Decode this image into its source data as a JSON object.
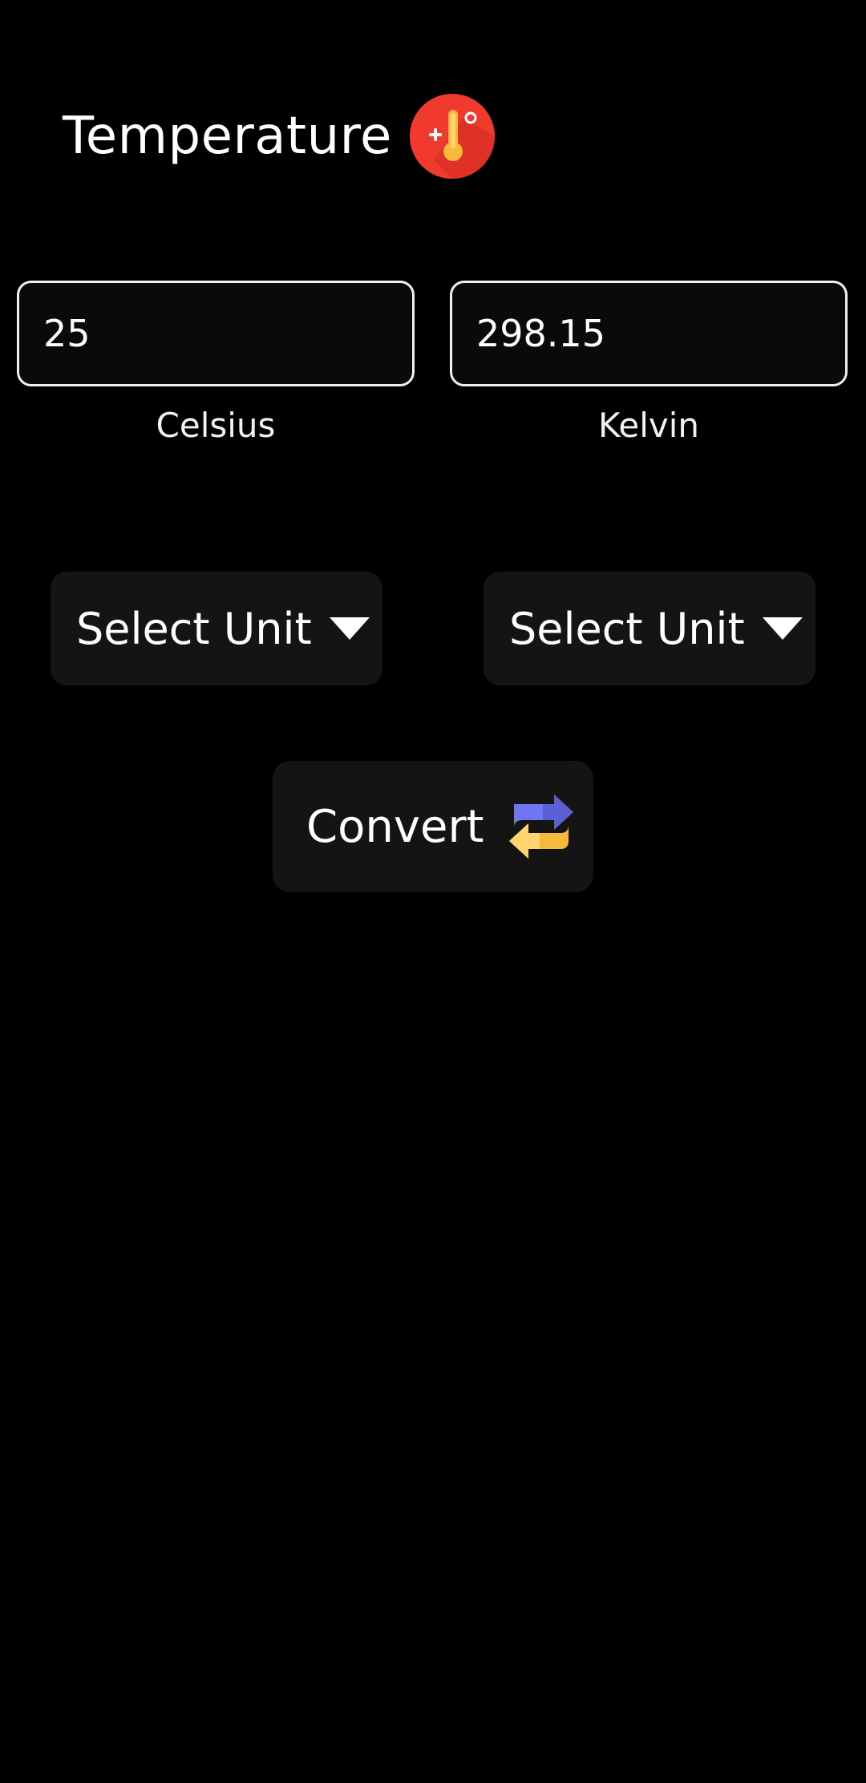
{
  "header": {
    "title": "Temperature",
    "icon": "thermometer-badge-icon",
    "icon_bg_color": "#f03a2e"
  },
  "converter": {
    "left": {
      "value": "25",
      "unit_label": "Celsius",
      "dropdown_label": "Select Unit"
    },
    "right": {
      "value": "298.15",
      "unit_label": "Kelvin",
      "dropdown_label": "Select Unit"
    },
    "convert_button": {
      "label": "Convert",
      "icon": "swap-arrows-icon"
    }
  },
  "colors": {
    "background": "#000000",
    "surface": "#141414",
    "text": "#ffffff",
    "field_border": "#f0f0f0",
    "swap_blue": "#6f76f2",
    "swap_yellow": "#f6b93b"
  }
}
